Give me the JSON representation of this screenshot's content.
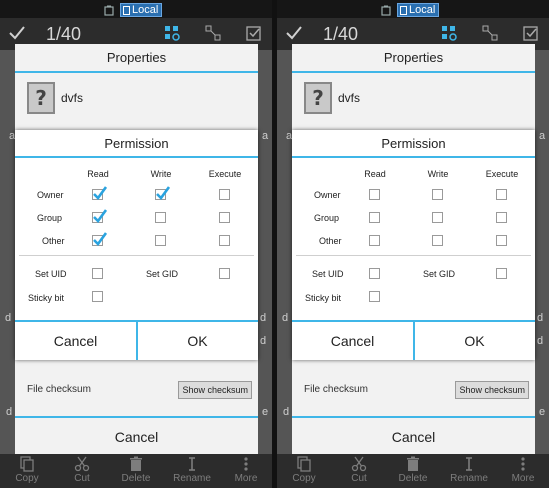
{
  "status": {
    "storage_label": "Local"
  },
  "toolbar": {
    "count": "1/40"
  },
  "background": {
    "ghost_letters": [
      "a",
      "a",
      "d",
      "d",
      "d",
      "e",
      "d",
      "d"
    ]
  },
  "properties": {
    "title": "Properties",
    "file_name": "dvfs",
    "file_icon_glyph": "?",
    "checksum_label": "File checksum",
    "checksum_button": "Show checksum",
    "cancel_label": "Cancel"
  },
  "permission": {
    "title": "Permission",
    "columns": [
      "Read",
      "Write",
      "Execute"
    ],
    "rows": [
      "Owner",
      "Group",
      "Other"
    ],
    "special_left": [
      "Set UID",
      "Sticky bit"
    ],
    "special_right": "Set GID",
    "cancel_label": "Cancel",
    "ok_label": "OK"
  },
  "panels": [
    {
      "name": "left",
      "checks": {
        "owner": [
          true,
          true,
          false
        ],
        "group": [
          true,
          false,
          false
        ],
        "other": [
          true,
          false,
          false
        ]
      },
      "special": {
        "set_uid": false,
        "set_gid": false,
        "sticky_bit": false
      }
    },
    {
      "name": "right",
      "checks": {
        "owner": [
          false,
          false,
          false
        ],
        "group": [
          false,
          false,
          false
        ],
        "other": [
          false,
          false,
          false
        ]
      },
      "special": {
        "set_uid": false,
        "set_gid": false,
        "sticky_bit": false
      }
    }
  ],
  "bottom_actions": [
    {
      "label": "Copy",
      "icon": "copy-icon"
    },
    {
      "label": "Cut",
      "icon": "scissors-icon"
    },
    {
      "label": "Delete",
      "icon": "trash-icon"
    },
    {
      "label": "Rename",
      "icon": "rename-icon"
    },
    {
      "label": "More",
      "icon": "more-icon"
    }
  ],
  "colors": {
    "accent": "#3fb6e8",
    "check": "#2aa3df",
    "statusbar": "#161616",
    "toolbar": "#2c2c2c"
  }
}
